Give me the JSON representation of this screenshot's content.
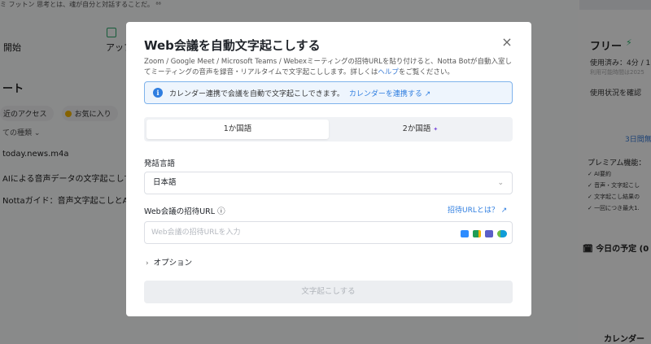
{
  "background": {
    "top_note": "ミ  フットン 思考とは、魂が自分と対話することだ。 ⁸⁸",
    "nav": {
      "start": "開始",
      "upload": "アップ"
    },
    "heading": "ート",
    "chips": {
      "recent": "近のアクセス",
      "favorite": "お気に入り"
    },
    "filter": "ての種類 ⌄",
    "files": [
      "today.news.m4a",
      "AIによる音声データの文字起こしで",
      "Nottaガイド：音声文字起こしとAI要"
    ],
    "sidebar": {
      "plan": "フリー",
      "used": "使用済み：4分 / 1",
      "used_note": "利用可能時間は2025",
      "usage_link": "使用状況を確認",
      "trial": "3日間無",
      "premium": "プレミアム機能：",
      "features": [
        "✓ AI要約",
        "✓ 音声・文字起こし",
        "✓ 文字起こし結果の",
        "✓ 一回につき最大1."
      ],
      "today": "今日の予定 (0",
      "calendar": "カレンダー"
    }
  },
  "modal": {
    "title": "Web会議を自動文字起こしする",
    "close": "×",
    "description": "Zoom / Google Meet / Microsoft Teams / Webexミーティングの招待URLを貼り付けると、Notta Botが自動入室してミーティングの音声を録音・リアルタイムで文字起こしします。詳しくは",
    "description_link": "ヘルプ",
    "description_end": "をご覧ください。",
    "info": {
      "icon": "i",
      "text": "カレンダー連携で会議を自動で文字起こしできます。",
      "link": "カレンダーを連携する ↗"
    },
    "segment": {
      "one_lang": "1か国語",
      "two_lang": "2か国語",
      "two_lang_badge": "✦"
    },
    "language": {
      "label": "発話言語",
      "value": "日本語",
      "chevron": "⌄"
    },
    "url": {
      "label": "Web会議の招待URL ⓘ",
      "help": "招待URLとは？ ↗",
      "placeholder": "Web会議の招待URLを入力"
    },
    "options": "オプション",
    "options_chevron": "›",
    "submit": "文字起こしする"
  }
}
